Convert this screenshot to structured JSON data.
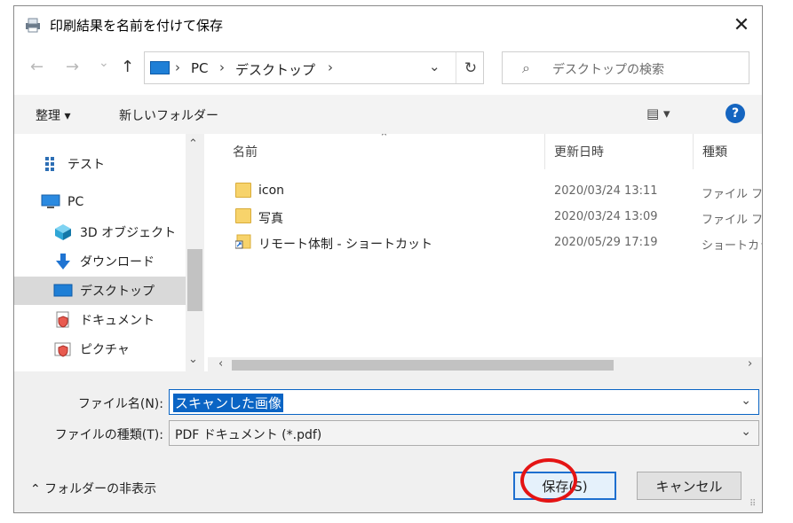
{
  "window": {
    "title": "印刷結果を名前を付けて保存",
    "close_glyph": "✕"
  },
  "nav": {
    "back_glyph": "←",
    "forward_glyph": "→",
    "recent_glyph": "⌄",
    "up_glyph": "↑"
  },
  "address": {
    "crumbs": [
      "PC",
      "デスクトップ"
    ],
    "separator": "›",
    "dropdown_glyph": "⌄",
    "refresh_glyph": "↻"
  },
  "search": {
    "placeholder": "デスクトップの検索",
    "icon_glyph": "⌕"
  },
  "toolbar": {
    "organize_label": "整理 ▾",
    "new_folder_label": "新しいフォルダー",
    "view_glyph": "▤ ▾",
    "help_glyph": "?"
  },
  "navpane": {
    "items": [
      {
        "label": "テスト",
        "icon": "network-grid-icon"
      },
      {
        "label": "PC",
        "icon": "pc-icon"
      },
      {
        "label": "3D オブジェクト",
        "icon": "cube-3d-icon"
      },
      {
        "label": "ダウンロード",
        "icon": "download-arrow-icon"
      },
      {
        "label": "デスクトップ",
        "icon": "desktop-icon",
        "selected": true
      },
      {
        "label": "ドキュメント",
        "icon": "document-shield-icon"
      },
      {
        "label": "ピクチャ",
        "icon": "picture-shield-icon"
      }
    ],
    "scroll_up": "⌃",
    "scroll_down": "⌄"
  },
  "filelist": {
    "columns": [
      "名前",
      "更新日時",
      "種類"
    ],
    "sort_glyph": "⌃",
    "rows": [
      {
        "name": "icon",
        "date": "2020/03/24 13:11",
        "type": "ファイル フォ",
        "icon": "folder-icon"
      },
      {
        "name": "写真",
        "date": "2020/03/24 13:09",
        "type": "ファイル フォ",
        "icon": "folder-icon"
      },
      {
        "name": "リモート体制 - ショートカット",
        "date": "2020/05/29 17:19",
        "type": "ショートカッ",
        "icon": "shortcut-icon"
      }
    ],
    "scroll_left": "‹",
    "scroll_right": "›"
  },
  "form": {
    "filename_label": "ファイル名(N):",
    "filename_value": "スキャンした画像",
    "filetype_label": "ファイルの種類(T):",
    "filetype_value": "PDF ドキュメント (*.pdf)",
    "dropdown_glyph": "⌄"
  },
  "footer": {
    "hide_folders_label": "⌃  フォルダーの非表示",
    "save_label": "保存(S)",
    "cancel_label": "キャンセル"
  },
  "colors": {
    "accent": "#0a64c4",
    "highlight_circle": "#e41414",
    "selected_row": "#d9d9d9"
  }
}
